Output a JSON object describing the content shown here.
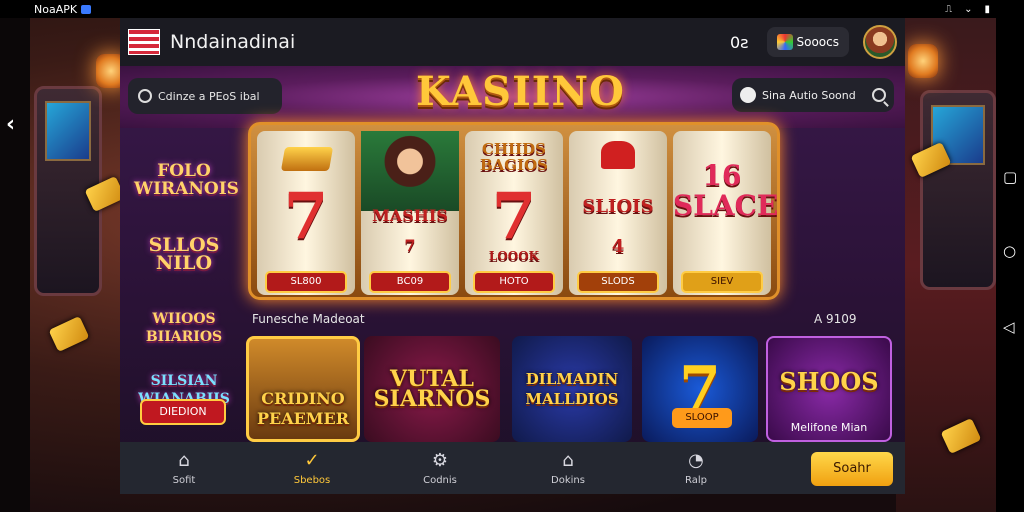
{
  "status_bar": {
    "title": "NoaAPK",
    "icons_right": [
      "vibrate-icon",
      "battery-icon"
    ]
  },
  "system_nav": {
    "back": "‹",
    "buttons": [
      "square-icon",
      "circle-icon",
      "triangle-icon"
    ]
  },
  "topbar": {
    "app_name": "Nndainadinai",
    "counter": "0ƨ",
    "wallet_label": "Sooocs"
  },
  "hero": {
    "logo_text": "KASIINO",
    "promo_text": "Cdinze a PEoS ibal",
    "search_placeholder": "Sina Autio Soond"
  },
  "sidebar": {
    "logos": [
      "FOLO\nWIRANOIS",
      "SLLOS\nNILO",
      "WIIOOS\nBIIARIOS",
      "SILSIAN\nWIANABIIS"
    ],
    "button_label": "DIEDION"
  },
  "reels": [
    {
      "top": "",
      "center": "7",
      "label": "SL800"
    },
    {
      "top": "",
      "center": "MASHIS\n7",
      "label": "BC09"
    },
    {
      "top": "CHIIDS\nBAGIOS",
      "center": "7",
      "mid": "LOOOK",
      "label": "HOTO"
    },
    {
      "top": "",
      "center": "SLIOIS\n4",
      "label": "SLODS"
    },
    {
      "top": "",
      "center": "16\nSLACE",
      "label": "SIEV"
    }
  ],
  "section": {
    "title": "Funesche Madeoat",
    "count": "A 9109"
  },
  "tiles": [
    {
      "title": "CRIDINO\nPEAEMER",
      "label": ""
    },
    {
      "title": "VUTAL\nSIARNOS",
      "label": ""
    },
    {
      "title": "DILMADIN\nMALLDIOS",
      "label": ""
    },
    {
      "title": "7",
      "label": "SLOOP"
    },
    {
      "title": "SHOOS",
      "label": "Melifone Mian"
    }
  ],
  "nav": [
    {
      "label": "Sofit",
      "icon": "home-icon"
    },
    {
      "label": "Sbebos",
      "icon": "shield-check-icon"
    },
    {
      "label": "Codnis",
      "icon": "gear-icon"
    },
    {
      "label": "Dokins",
      "icon": "lock-house-icon"
    },
    {
      "label": "Ralp",
      "icon": "chat-icon"
    }
  ],
  "cta_label": "Soahr",
  "colors": {
    "accent": "#ffc83a",
    "nav_bg": "#242730",
    "topbar_bg": "#1b1b22",
    "red": "#b21a1a"
  }
}
